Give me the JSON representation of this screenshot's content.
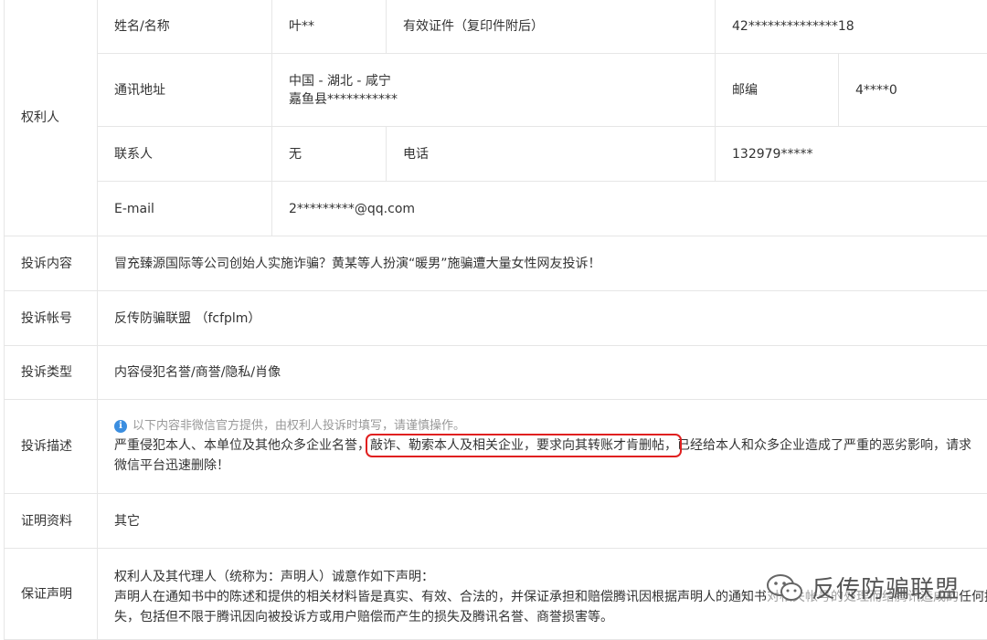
{
  "rights_holder": {
    "section_label": "权利人",
    "name_label": "姓名/名称",
    "name_value": "叶**",
    "id_label": "有效证件（复印件附后）",
    "id_value": "42**************18",
    "address_label": "通讯地址",
    "address_line1": "中国 - 湖北 - 咸宁",
    "address_line2": "嘉鱼县***********",
    "postcode_label": "邮编",
    "postcode_value": "4****0",
    "contact_label": "联系人",
    "contact_value": "无",
    "phone_label": "电话",
    "phone_value": "132979*****",
    "email_label": "E-mail",
    "email_value": "2*********@qq.com"
  },
  "complaint": {
    "content_label": "投诉内容",
    "content_value": "冒充臻源国际等公司创始人实施诈骗？黄某等人扮演“暖男”施骗遭大量女性网友投诉！",
    "account_label": "投诉帐号",
    "account_value": "反传防骗联盟 （fcfplm）",
    "type_label": "投诉类型",
    "type_value": "内容侵犯名誉/商誉/隐私/肖像",
    "desc_label": "投诉描述",
    "desc_hint": "以下内容非微信官方提供，由权利人投诉时填写，请谨慎操作。",
    "desc_part1": "严重侵犯本人、本单位及其他众多企业名誉，",
    "desc_highlight": "敲诈、勒索本人及相关企业，要求向其转账才肯删帖，",
    "desc_part2": "已经给本人和众多企业造成了严重的恶劣影响，请求微信平台迅速删除！",
    "evidence_label": "证明资料",
    "evidence_value": "其它",
    "guarantee_label": "保证声明",
    "guarantee_line1": "权利人及其代理人（统称为：声明人）诚意作如下声明：",
    "guarantee_line2": "声明人在通知书中的陈述和提供的相关材料皆是真实、有效、合法的，并保证承担和赔偿腾讯因根据声明人的通知书对相关帐号的处理而给腾讯造成的任何损",
    "guarantee_line3": "失，包括但不限于腾讯因向被投诉方或用户赔偿而产生的损失及腾讯名誉、商誉损害等。"
  },
  "watermark": {
    "text": "反传防骗联盟",
    "icon": "wechat-official-account-icon"
  },
  "colors": {
    "border": "#e6e6e6",
    "highlight_box": "#e02020",
    "info_icon": "#3b8ee0",
    "hint_text": "#999999"
  }
}
